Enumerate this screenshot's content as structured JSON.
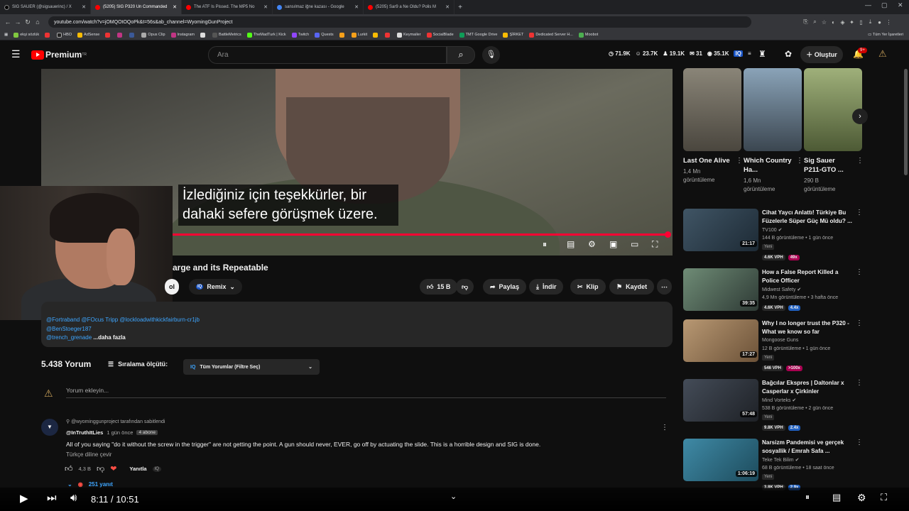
{
  "browser": {
    "tabs": [
      {
        "label": "SIG SAUER (@sigsauerinc) / X",
        "color": "#000000",
        "active": false
      },
      {
        "label": "(5205) SIG P320 Un Commanded",
        "color": "#ff0000",
        "active": true
      },
      {
        "label": "The ATF Is Pissed. The MP5 No",
        "color": "#ff0000",
        "active": false
      },
      {
        "label": "sansılmaz iğne kazası - Google",
        "color": "#4285f4",
        "active": false
      },
      {
        "label": "(5205) Sar9 a Ne Oldu? Polis M",
        "color": "#ff0000",
        "active": false
      }
    ],
    "new_tab": "+",
    "url": "youtube.com/watch?v=jOMQOtOQoPk&t=56s&ab_channel=WyomingGunProject",
    "bookmarks": [
      "ekşi sözlük",
      "HBO",
      "AdSense",
      "Opus Clip",
      "Instagram",
      "BattleMetrics",
      "TheMadTurk | Kick",
      "Twitch",
      "Quests",
      "Lurkit",
      "Keymailer",
      "SocialBlade",
      "TMT Google Drive",
      "ŞİRKET",
      "Dedicated Server H...",
      "Moobot"
    ],
    "all_bookmarks": "Tüm Yer İşaretleri"
  },
  "header": {
    "logo_text": "Premium",
    "logo_sup": "TR",
    "search_placeholder": "Ara",
    "stats": [
      "71.9K",
      "23.7K",
      "19.1K",
      "31",
      "35.1K"
    ],
    "create_label": "Oluştur",
    "notif_count": "9+"
  },
  "player": {
    "caption_line1": "İzlediğiniz için teşekkürler, bir",
    "caption_line2": "dahaki sefere görüşmek üzere.",
    "progress": 0.78,
    "current_time": "8:11",
    "duration": "10:51",
    "time_sep": " / "
  },
  "video": {
    "title_fragment": "arge and its Repeatable",
    "subscribe_fragment": "ol",
    "remix_label": "Remix",
    "like_count": "15 B",
    "share_label": "Paylaş",
    "download_label": "İndir",
    "clip_label": "Klip",
    "save_label": "Kaydet"
  },
  "description": {
    "line1": "@Fortraband @FOcus Tripp @lockloadwithkickfairburn-cr1jb",
    "line2": "@BenStoeger187",
    "line3": "@trench_grenade",
    "more": "...daha fazla"
  },
  "comments": {
    "count": "5.438 Yorum",
    "sort_label": "Sıralama ölçütü:",
    "sort_value": "Tüm Yorumlar (Filtre Seç)",
    "add_placeholder": "Yorum ekleyin...",
    "pinned_by": "@wyominggunproject tarafından sabitlendi",
    "author": "@InTruthItLies",
    "time": "1 gün önce",
    "author_badge": "4 abone",
    "text": "All of you saying \"do it without the screw in the trigger\" are not getting the point. A gun should never, EVER, go off by actuating the slide. This is a horrible design and SIG is done.",
    "translate": "Türkçe diline çevir",
    "likes": "4,3 B",
    "reply_label": "Yanıtla",
    "replies": "251 yanıt"
  },
  "shelf": [
    {
      "title": "Last One Alive",
      "meta1": "1,4 Mn",
      "meta2": "görüntüleme",
      "color": "#6f6a60"
    },
    {
      "title": "Which Country Ha...",
      "meta1": "1,6 Mn",
      "meta2": "görüntüleme",
      "color": "#5b6772"
    },
    {
      "title": "Sig Sauer P211-GTO ...",
      "meta1": "290 B",
      "meta2": "görüntüleme",
      "color": "#6d7a52"
    }
  ],
  "recommendations": [
    {
      "title": "Cihat Yaycı Anlattı! Türkiye Bu Füzelerle Süper Güç Mü oldu? ...",
      "channel": "TV100",
      "meta": "144 B görüntüleme • 1 gün önce",
      "badge": "Yeni",
      "duration": "21:17",
      "vph": "4.6K VPH",
      "mult": "49x",
      "mult_color": "#a80050",
      "color": "#3d4f5e"
    },
    {
      "title": "How a False Report Killed a Police Officer",
      "channel": "Midwest Safety",
      "meta": "4,9 Mn görüntüleme • 3 hafta önce",
      "badge": "",
      "duration": "39:35",
      "vph": "4.6K VPH",
      "mult": "4.4x",
      "mult_color": "#1f5fbf",
      "color": "#5b7a63"
    },
    {
      "title": "Why I no longer trust the P320 - What we know so far",
      "channel": "Mongoose Guns",
      "meta": "12 B görüntüleme • 1 gün önce",
      "badge": "Yeni",
      "duration": "17:27",
      "vph": "546 VPH",
      "mult": ">100x",
      "mult_color": "#a80050",
      "color": "#8a6f55"
    },
    {
      "title": "Bağcılar Ekspres | Daltonlar x Casperlar x Çirkinler",
      "channel": "Mind Vorteks",
      "meta": "538 B görüntüleme • 2 gün önce",
      "badge": "Yeni",
      "duration": "57:48",
      "vph": "9.8K VPH",
      "mult": "2.4x",
      "mult_color": "#1f5fbf",
      "color": "#333a44"
    },
    {
      "title": "Narsizm Pandemisi ve gerçek sosyallik / Emrah Safa ...",
      "channel": "Teke Tek Bilim",
      "meta": "68 B görüntüleme • 18 saat önce",
      "badge": "Yeni",
      "duration": "1:06:19",
      "vph": "3.8K VPH",
      "mult": "2.9x",
      "mult_color": "#1f5fbf",
      "color": "#2f6f86"
    }
  ],
  "colors": {
    "accent": "#ff0033",
    "link": "#3ea6ff",
    "bg": "#0f0f0f"
  }
}
